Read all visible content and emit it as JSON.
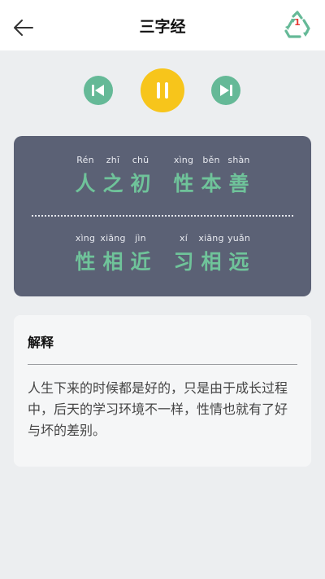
{
  "header": {
    "title": "三字经",
    "back_icon": "back-arrow-icon",
    "recycle_icon": "recycle-icon",
    "recycle_badge": "1",
    "recycle_color": "#65b997"
  },
  "player": {
    "prev_icon": "previous-icon",
    "play_icon": "pause-icon",
    "next_icon": "next-icon",
    "accent_green": "#65b997",
    "accent_yellow": "#f7c51b"
  },
  "verse": {
    "lines": [
      {
        "chars": [
          {
            "pinyin": "Rén",
            "hanzi": "人"
          },
          {
            "pinyin": "zhī",
            "hanzi": "之"
          },
          {
            "pinyin": "chū",
            "hanzi": "初"
          },
          {
            "pinyin": "xìng",
            "hanzi": "性"
          },
          {
            "pinyin": "běn",
            "hanzi": "本"
          },
          {
            "pinyin": "shàn",
            "hanzi": "善"
          }
        ]
      },
      {
        "chars": [
          {
            "pinyin": "xìng",
            "hanzi": "性"
          },
          {
            "pinyin": "xiāng",
            "hanzi": "相"
          },
          {
            "pinyin": "jìn",
            "hanzi": "近"
          },
          {
            "pinyin": "xí",
            "hanzi": "习"
          },
          {
            "pinyin": "xiāng",
            "hanzi": "相"
          },
          {
            "pinyin": "yuǎn",
            "hanzi": "远"
          }
        ]
      }
    ],
    "card_color": "#5b6175",
    "hanzi_color": "#6fc39a"
  },
  "explanation": {
    "heading": "解释",
    "text": "人生下来的时候都是好的，只是由于成长过程中，后天的学习环境不一样，性情也就有了好与坏的差别。"
  }
}
